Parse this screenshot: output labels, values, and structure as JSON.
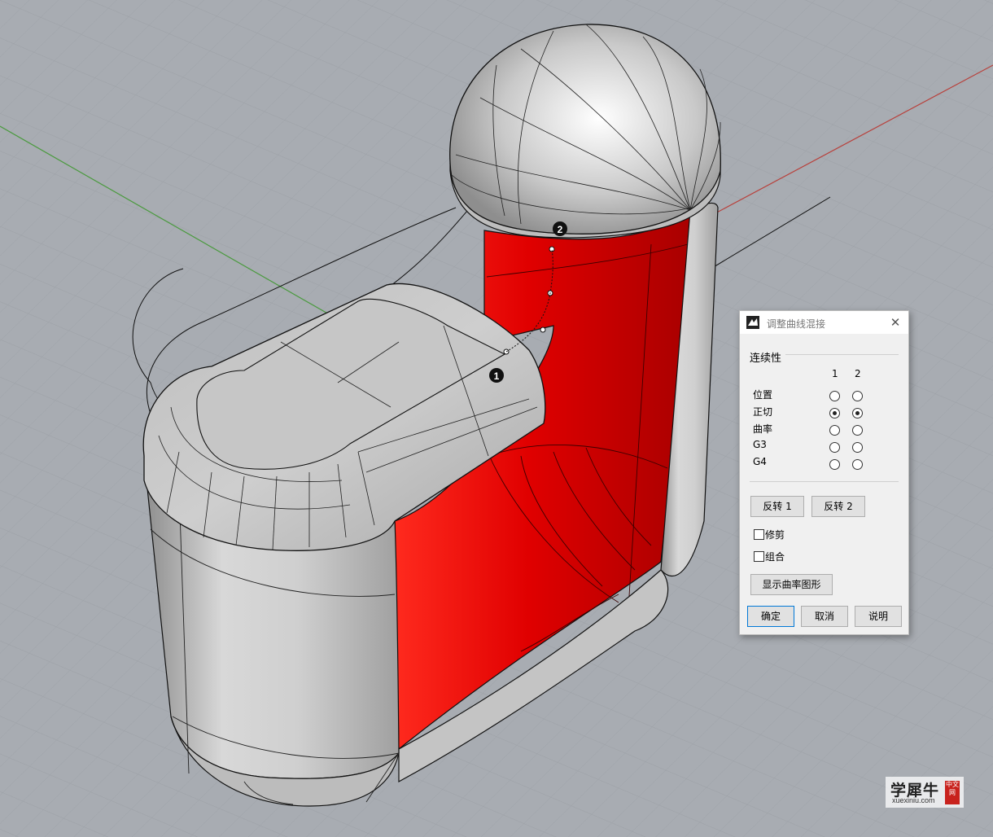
{
  "dialog": {
    "title": "调整曲线混接",
    "close_glyph": "✕",
    "group_label": "连续性",
    "columns": [
      "1",
      "2"
    ],
    "rows": [
      {
        "label": "位置",
        "selected": [
          false,
          false
        ]
      },
      {
        "label": "正切",
        "selected": [
          true,
          true
        ]
      },
      {
        "label": "曲率",
        "selected": [
          false,
          false
        ]
      },
      {
        "label": "G3",
        "selected": [
          false,
          false
        ]
      },
      {
        "label": "G4",
        "selected": [
          false,
          false
        ]
      }
    ],
    "reverse1_label": "反转 1",
    "reverse2_label": "反转 2",
    "trim_label": "修剪",
    "trim_checked": false,
    "join_label": "组合",
    "join_checked": false,
    "show_curvature_label": "显示曲率图形",
    "ok_label": "确定",
    "cancel_label": "取消",
    "help_label": "说明"
  },
  "viewport": {
    "marker_1": "1",
    "marker_2": "2",
    "colors": {
      "background": "#a8acb2",
      "grid": "#9ea2a8",
      "x_axis": "#b8413c",
      "y_axis": "#4a9a3e",
      "surface_red": "#e60000",
      "surface_gray": "#c8c8c8"
    }
  },
  "watermark": {
    "text_cn": "学犀牛",
    "text_en": "xuexiniu.com",
    "seal": "中文网"
  }
}
